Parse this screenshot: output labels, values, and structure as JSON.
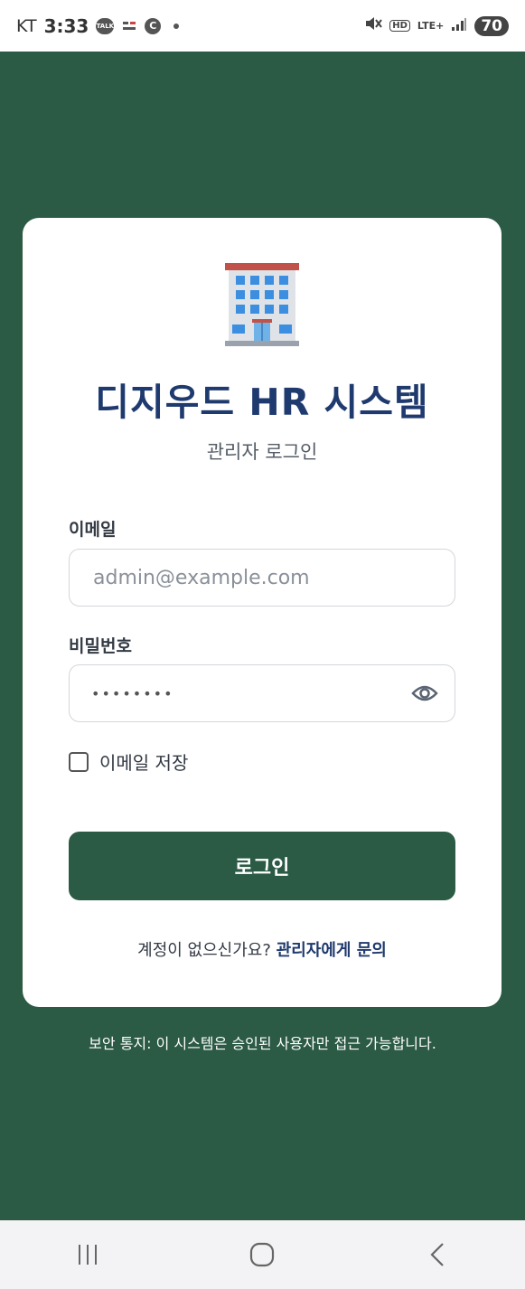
{
  "status_bar": {
    "carrier": "KT",
    "time": "3:33",
    "notification_icons": [
      "talk-icon",
      "notification-icon",
      "c-badge-icon"
    ],
    "talk_label": "TALK",
    "c_label": "C",
    "hd_label": "HD",
    "lte_label": "LTE+",
    "battery": "70"
  },
  "login": {
    "title": "디지우드 HR 시스템",
    "subtitle": "관리자 로그인",
    "email_label": "이메일",
    "email_placeholder": "admin@example.com",
    "password_label": "비밀번호",
    "password_value": "••••••••",
    "remember_label": "이메일 저장",
    "remember_checked": false,
    "login_button": "로그인",
    "no_account_text": "계정이 없으신가요?",
    "contact_link": "관리자에게 문의"
  },
  "notice": "보안 통지: 이 시스템은 승인된 사용자만 접근 가능합니다.",
  "colors": {
    "background": "#2b5a45",
    "card": "#ffffff",
    "title": "#1f3a6e",
    "button": "#2b5a45"
  },
  "nav": {
    "recent": "recent-apps-icon",
    "home": "home-icon",
    "back": "back-icon"
  }
}
